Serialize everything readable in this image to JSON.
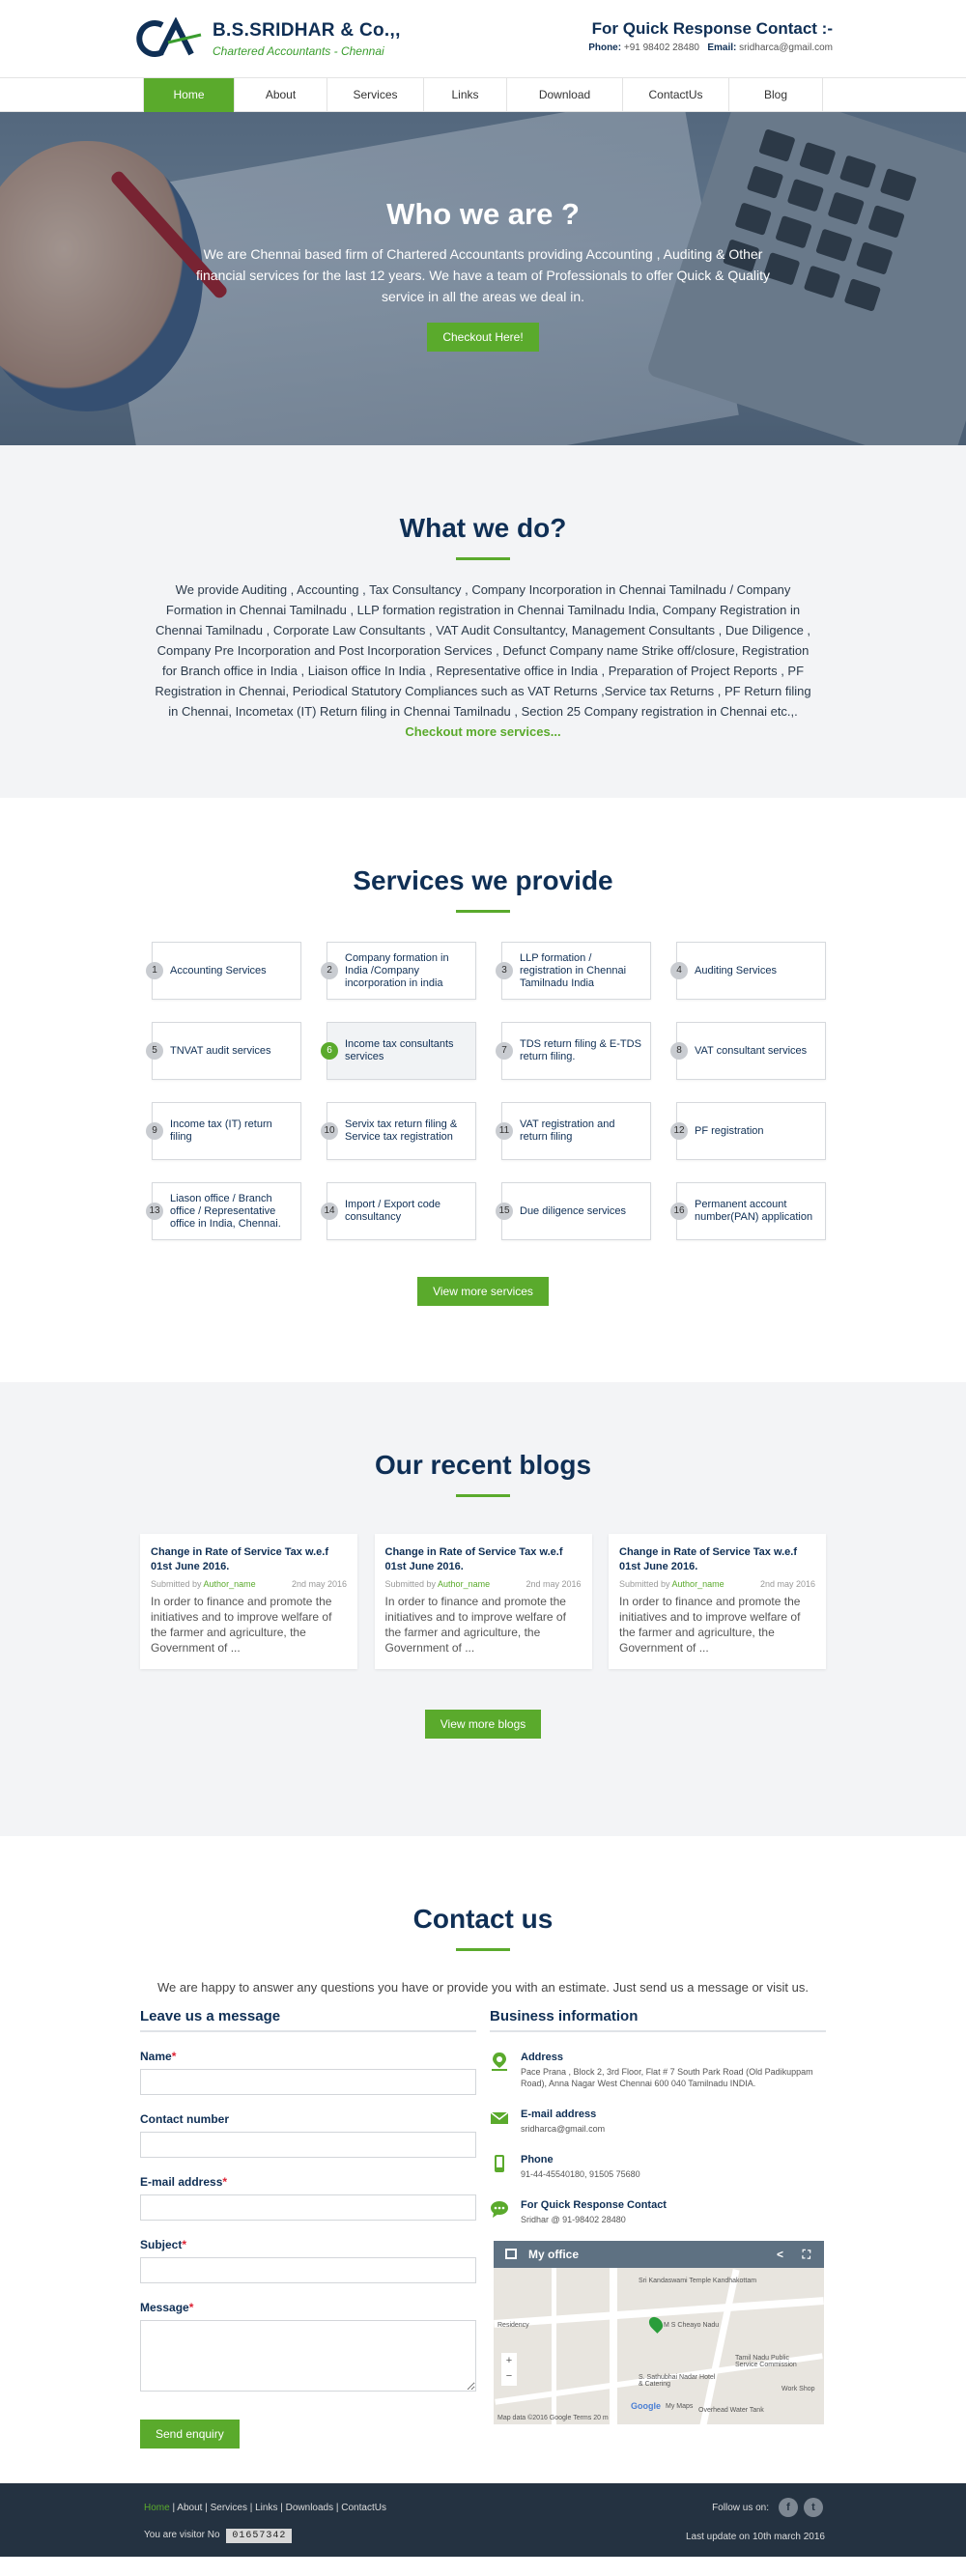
{
  "brand": {
    "name": "B.S.SRIDHAR & Co.,,",
    "tagline": "Chartered Accountants - Chennai",
    "logo_text": "CA"
  },
  "header": {
    "contact_title": "For Quick Response Contact :-",
    "phone_label": "Phone:",
    "phone_value": "+91 98402 28480",
    "email_label": "Email:",
    "email_value": "sridharca@gmail.com"
  },
  "nav": {
    "items": [
      "Home",
      "About",
      "Services",
      "Links",
      "Download",
      "ContactUs",
      "Blog"
    ],
    "active": "Home"
  },
  "hero": {
    "title": "Who we are ?",
    "text": "We are Chennai based firm of Chartered Accountants providing Accounting , Auditing & Other financial services for the last 12 years. We have a team of Professionals to offer Quick & Quality service in all the areas we deal in.",
    "cta": "Checkout Here!"
  },
  "whatwedo": {
    "title": "What we do?",
    "text": "We provide Auditing , Accounting , Tax Consultancy , Company Incorporation in Chennai Tamilnadu / Company Formation in Chennai Tamilnadu , LLP formation registration in Chennai Tamilnadu India, Company Registration in Chennai Tamilnadu , Corporate Law Consultants , VAT Audit Consultantcy, Management Consultants , Due Diligence , Company Pre Incorporation and Post Incorporation Services , Defunct Company name Strike off/closure, Registration for Branch office in India , Liaison office In India , Representative office in India , Preparation of Project Reports , PF Registration in Chennai, Periodical Statutory Compliances such as VAT Returns ,Service tax Returns , PF Return filing in Chennai, Incometax (IT) Return filing in Chennai Tamilnadu , Section 25 Company registration in Chennai etc.,.",
    "link": "Checkout more services..."
  },
  "services": {
    "title": "Services we provide",
    "items": [
      {
        "n": "1",
        "label": "Accounting Services"
      },
      {
        "n": "2",
        "label": "Company formation in India /Company incorporation in india"
      },
      {
        "n": "3",
        "label": "LLP formation / registration in Chennai Tamilnadu India"
      },
      {
        "n": "4",
        "label": "Auditing Services"
      },
      {
        "n": "5",
        "label": "TNVAT audit services"
      },
      {
        "n": "6",
        "label": "Income tax consultants services"
      },
      {
        "n": "7",
        "label": "TDS return filing & E-TDS return filing."
      },
      {
        "n": "8",
        "label": "VAT consultant services"
      },
      {
        "n": "9",
        "label": "Income tax (IT) return filing"
      },
      {
        "n": "10",
        "label": "Servix tax return filing & Service tax registration"
      },
      {
        "n": "11",
        "label": "VAT registration and return filing"
      },
      {
        "n": "12",
        "label": "PF registration"
      },
      {
        "n": "13",
        "label": "Liason office / Branch office / Representative office in India, Chennai."
      },
      {
        "n": "14",
        "label": "Import / Export code consultancy"
      },
      {
        "n": "15",
        "label": "Due diligence services"
      },
      {
        "n": "16",
        "label": "Permanent account number(PAN) application"
      }
    ],
    "more": "View more services"
  },
  "blogs": {
    "title": "Our recent blogs",
    "items": [
      {
        "title": "Change in Rate of Service Tax w.e.f 01st June 2016.",
        "by": "Submitted by",
        "author": "Author_name",
        "date": "2nd may 2016",
        "excerpt": "In order to finance and promote the initiatives and to improve welfare of the farmer and agriculture, the Government of ..."
      },
      {
        "title": "Change in Rate of Service Tax w.e.f 01st June 2016.",
        "by": "Submitted by",
        "author": "Author_name",
        "date": "2nd may 2016",
        "excerpt": "In order to finance and promote the initiatives and to improve welfare of the farmer and agriculture, the Government of ..."
      },
      {
        "title": "Change in Rate of Service Tax w.e.f 01st June 2016.",
        "by": "Submitted by",
        "author": "Author_name",
        "date": "2nd may 2016",
        "excerpt": "In order to finance and promote the initiatives and to improve welfare of the farmer and agriculture, the Government of ..."
      }
    ],
    "more": "View more blogs"
  },
  "contact": {
    "title": "Contact us",
    "intro": "We are happy to answer any questions you have or provide you with an estimate. Just send us a message or visit us.",
    "form_title": "Leave us a message",
    "fields": [
      {
        "label": "Name",
        "required": true
      },
      {
        "label": "Contact number",
        "required": false
      },
      {
        "label": "E-mail address",
        "required": true
      },
      {
        "label": "Subject",
        "required": true
      },
      {
        "label": "Message",
        "required": true
      }
    ],
    "send": "Send enquiry",
    "info_title": "Business information",
    "info": [
      {
        "icon": "location-pin-icon",
        "title": "Address",
        "value": "Pace Prana , Block 2, 3rd Floor, Flat # 7 South Park Road (Old Padikuppam Road), Anna Nagar West Chennai 600 040 Tamilnadu INDIA."
      },
      {
        "icon": "envelope-icon",
        "title": "E-mail address",
        "value": "sridharca@gmail.com"
      },
      {
        "icon": "mobile-phone-icon",
        "title": "Phone",
        "value": "91-44-45540180, 91505 75680"
      },
      {
        "icon": "chat-bubble-icon",
        "title": "For Quick Response Contact",
        "value": "Sridhar @ 91-98402 28480"
      }
    ],
    "map": {
      "title": "My office",
      "labels": [
        "Sri Kandaswami Temple Kandhakottam",
        "M S Cheayo Nadu",
        "Tamil Nadu Public Service Commission",
        "S. Sathubhai Nadar Hotel & Catering",
        "Overhead Water Tank",
        "Work Shop",
        "Residency",
        "Google",
        "My Maps"
      ],
      "footer": "Map data ©2016 Google   Terms   20 m"
    }
  },
  "footer": {
    "links": [
      "Home",
      "About",
      "Services",
      "Links",
      "Downloads",
      "ContactUs"
    ],
    "visitor_label": "You are visitor No",
    "visitor_count": "01657342",
    "follow": "Follow us on:",
    "social": [
      "f",
      "t"
    ],
    "updated": "Last update on 10th march 2016"
  },
  "colors": {
    "accent": "#5aaa2c",
    "navy": "#0f2f55",
    "footer": "#243241"
  }
}
